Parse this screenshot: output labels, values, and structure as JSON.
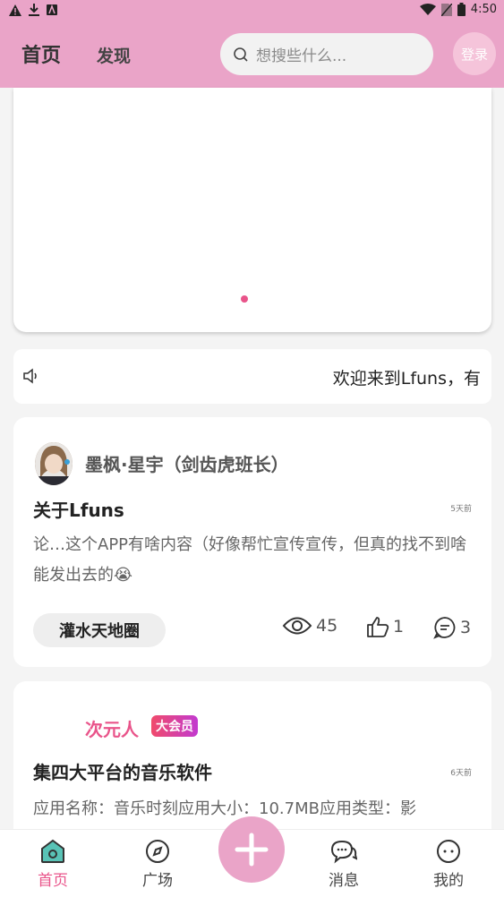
{
  "status_bar": {
    "time": "4:50",
    "icons": [
      "warning-icon",
      "download-icon",
      "a-icon",
      "wifi-icon",
      "no-sim-icon",
      "battery-icon"
    ]
  },
  "header": {
    "tab_home": "首页",
    "tab_discover": "发现",
    "search_placeholder": "想搜些什么...",
    "login_label": "登录"
  },
  "notice": {
    "text": "欢迎来到Lfuns，有"
  },
  "posts": [
    {
      "author": "墨枫·星宇（剑齿虎班长）",
      "title": "关于Lfuns",
      "time": "5天前",
      "body": "论…这个APP有啥内容（好像帮忙宣传宣传，但真的找不到啥能发出去的😭",
      "tag": "灌水天地圈",
      "views": "45",
      "likes": "1",
      "comments": "3"
    },
    {
      "author": "次元人",
      "badge": "大会员",
      "title": "集四大平台的音乐软件",
      "time": "6天前",
      "body": "应用名称：音乐时刻应用大小：10.7MB应用类型：影"
    }
  ],
  "bottom_nav": {
    "home": "首页",
    "square": "广场",
    "messages": "消息",
    "me": "我的"
  },
  "colors": {
    "brand_pink": "#eaa4c8",
    "accent": "#e9548a"
  }
}
